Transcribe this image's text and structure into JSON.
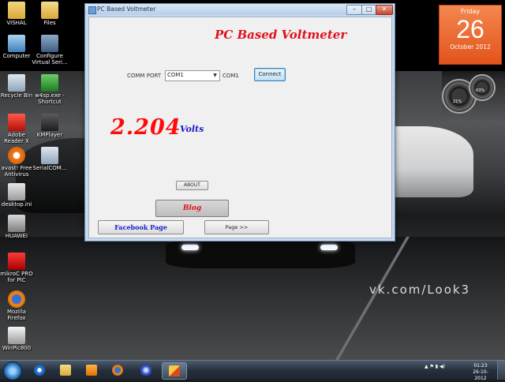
{
  "desktop": {
    "icons": [
      {
        "label": "VISHAL"
      },
      {
        "label": "Files"
      },
      {
        "label": "Computer"
      },
      {
        "label": "Configure Virtual Seri..."
      },
      {
        "label": "Recycle Bin"
      },
      {
        "label": "w4sp.exe - Shortcut"
      },
      {
        "label": "Adobe Reader X"
      },
      {
        "label": "KMPlayer"
      },
      {
        "label": "avast! Free Antivirus"
      },
      {
        "label": "SerialCOM..."
      },
      {
        "label": "desktop.ini"
      },
      {
        "label": "HUAWEI"
      },
      {
        "label": "mikroC PRO for PIC"
      },
      {
        "label": "Mozilla Firefox"
      },
      {
        "label": "WinPic800"
      }
    ],
    "watermark": "vk.com/Look3"
  },
  "calendar_gadget": {
    "weekday": "Friday",
    "day": "26",
    "month_year": "October 2012"
  },
  "meter_gadget": {
    "cpu_percent": "21%",
    "memory_percent": "63%"
  },
  "window": {
    "title": "PC Based Voltmeter",
    "minimize_label": "–",
    "maximize_label": "□",
    "close_label": "✕",
    "app_title": "PC Based Voltmeter",
    "comm_port_label": "COMM PORT",
    "comm_port_value": "COM1",
    "selected_port_text": "COM1",
    "connect_label": "Connect",
    "reading_value": "2.204",
    "reading_unit": "Volts",
    "about_label": "ABOUT",
    "blog_label": "Blog",
    "facebook_label": "Facebook Page",
    "next_page_label": "Page >>"
  },
  "taskbar": {
    "clock_time": "01:23",
    "clock_date": "26-10-2012"
  }
}
